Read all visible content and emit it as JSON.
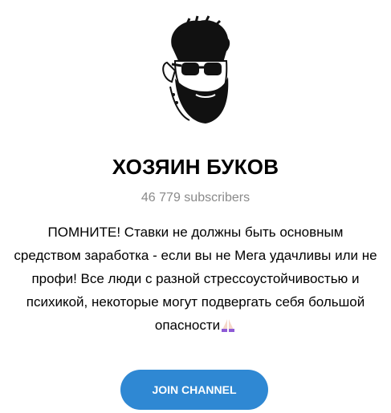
{
  "channel": {
    "title": "ХОЗЯИН БУКОВ",
    "subscribers": "46 779 subscribers",
    "description": "ПОМНИТЕ! Ставки не должны быть основным средством заработка - если вы не Мега удачливы или не профи! Все люди с разной стрессоустойчивостью и психикой, некоторые могут подвергать себя большой опасности",
    "description_emoji": "praying-hands-icon",
    "avatar_icon": "bearded-man-sunglasses-icon"
  },
  "actions": {
    "join_label": "JOIN CHANNEL"
  },
  "colors": {
    "accent": "#2f88d3",
    "muted_text": "#8a8a8a"
  }
}
